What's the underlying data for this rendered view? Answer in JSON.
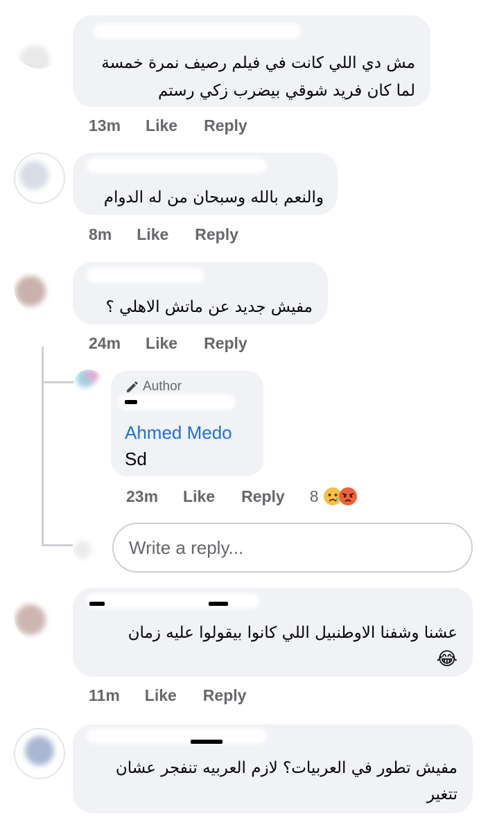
{
  "comments": [
    {
      "text_line1": "مش دي اللي كانت في فيلم رصيف نمرة خمسة",
      "text_line2": "لما كان فريد شوقي بيضرب زكي رستم",
      "time": "13m",
      "like": "Like",
      "reply": "Reply"
    },
    {
      "text_line1": "والنعم بالله وسبحان من له الدوام",
      "time": "8m",
      "like": "Like",
      "reply": "Reply"
    },
    {
      "text_line1": "مفيش جديد عن ماتش الاهلي ؟",
      "time": "24m",
      "like": "Like",
      "reply": "Reply"
    },
    {
      "text_line1": "عشنا وشفنا الاوطنبيل اللي كانوا بيقولوا عليه زمان",
      "emoji": "😂",
      "time": "11m",
      "like": "Like",
      "reply": "Reply"
    },
    {
      "text_line1": "مفيش تطور في العربيات؟  لازم العربيه تنفجر عشان",
      "text_line2": "تتغير"
    }
  ],
  "reply": {
    "badge": "Author",
    "mention": "Ahmed Medo",
    "text": "Sd",
    "time": "23m",
    "like": "Like",
    "reply": "Reply",
    "reaction_count": "8",
    "reaction_icons": [
      "sad-face",
      "angry-face"
    ]
  },
  "reply_input": {
    "placeholder": "Write a reply..."
  },
  "colors": {
    "bubble": "#f0f2f5",
    "meta_text": "#65676b",
    "link": "#216fdb",
    "thread_line": "#ccd0d5"
  }
}
